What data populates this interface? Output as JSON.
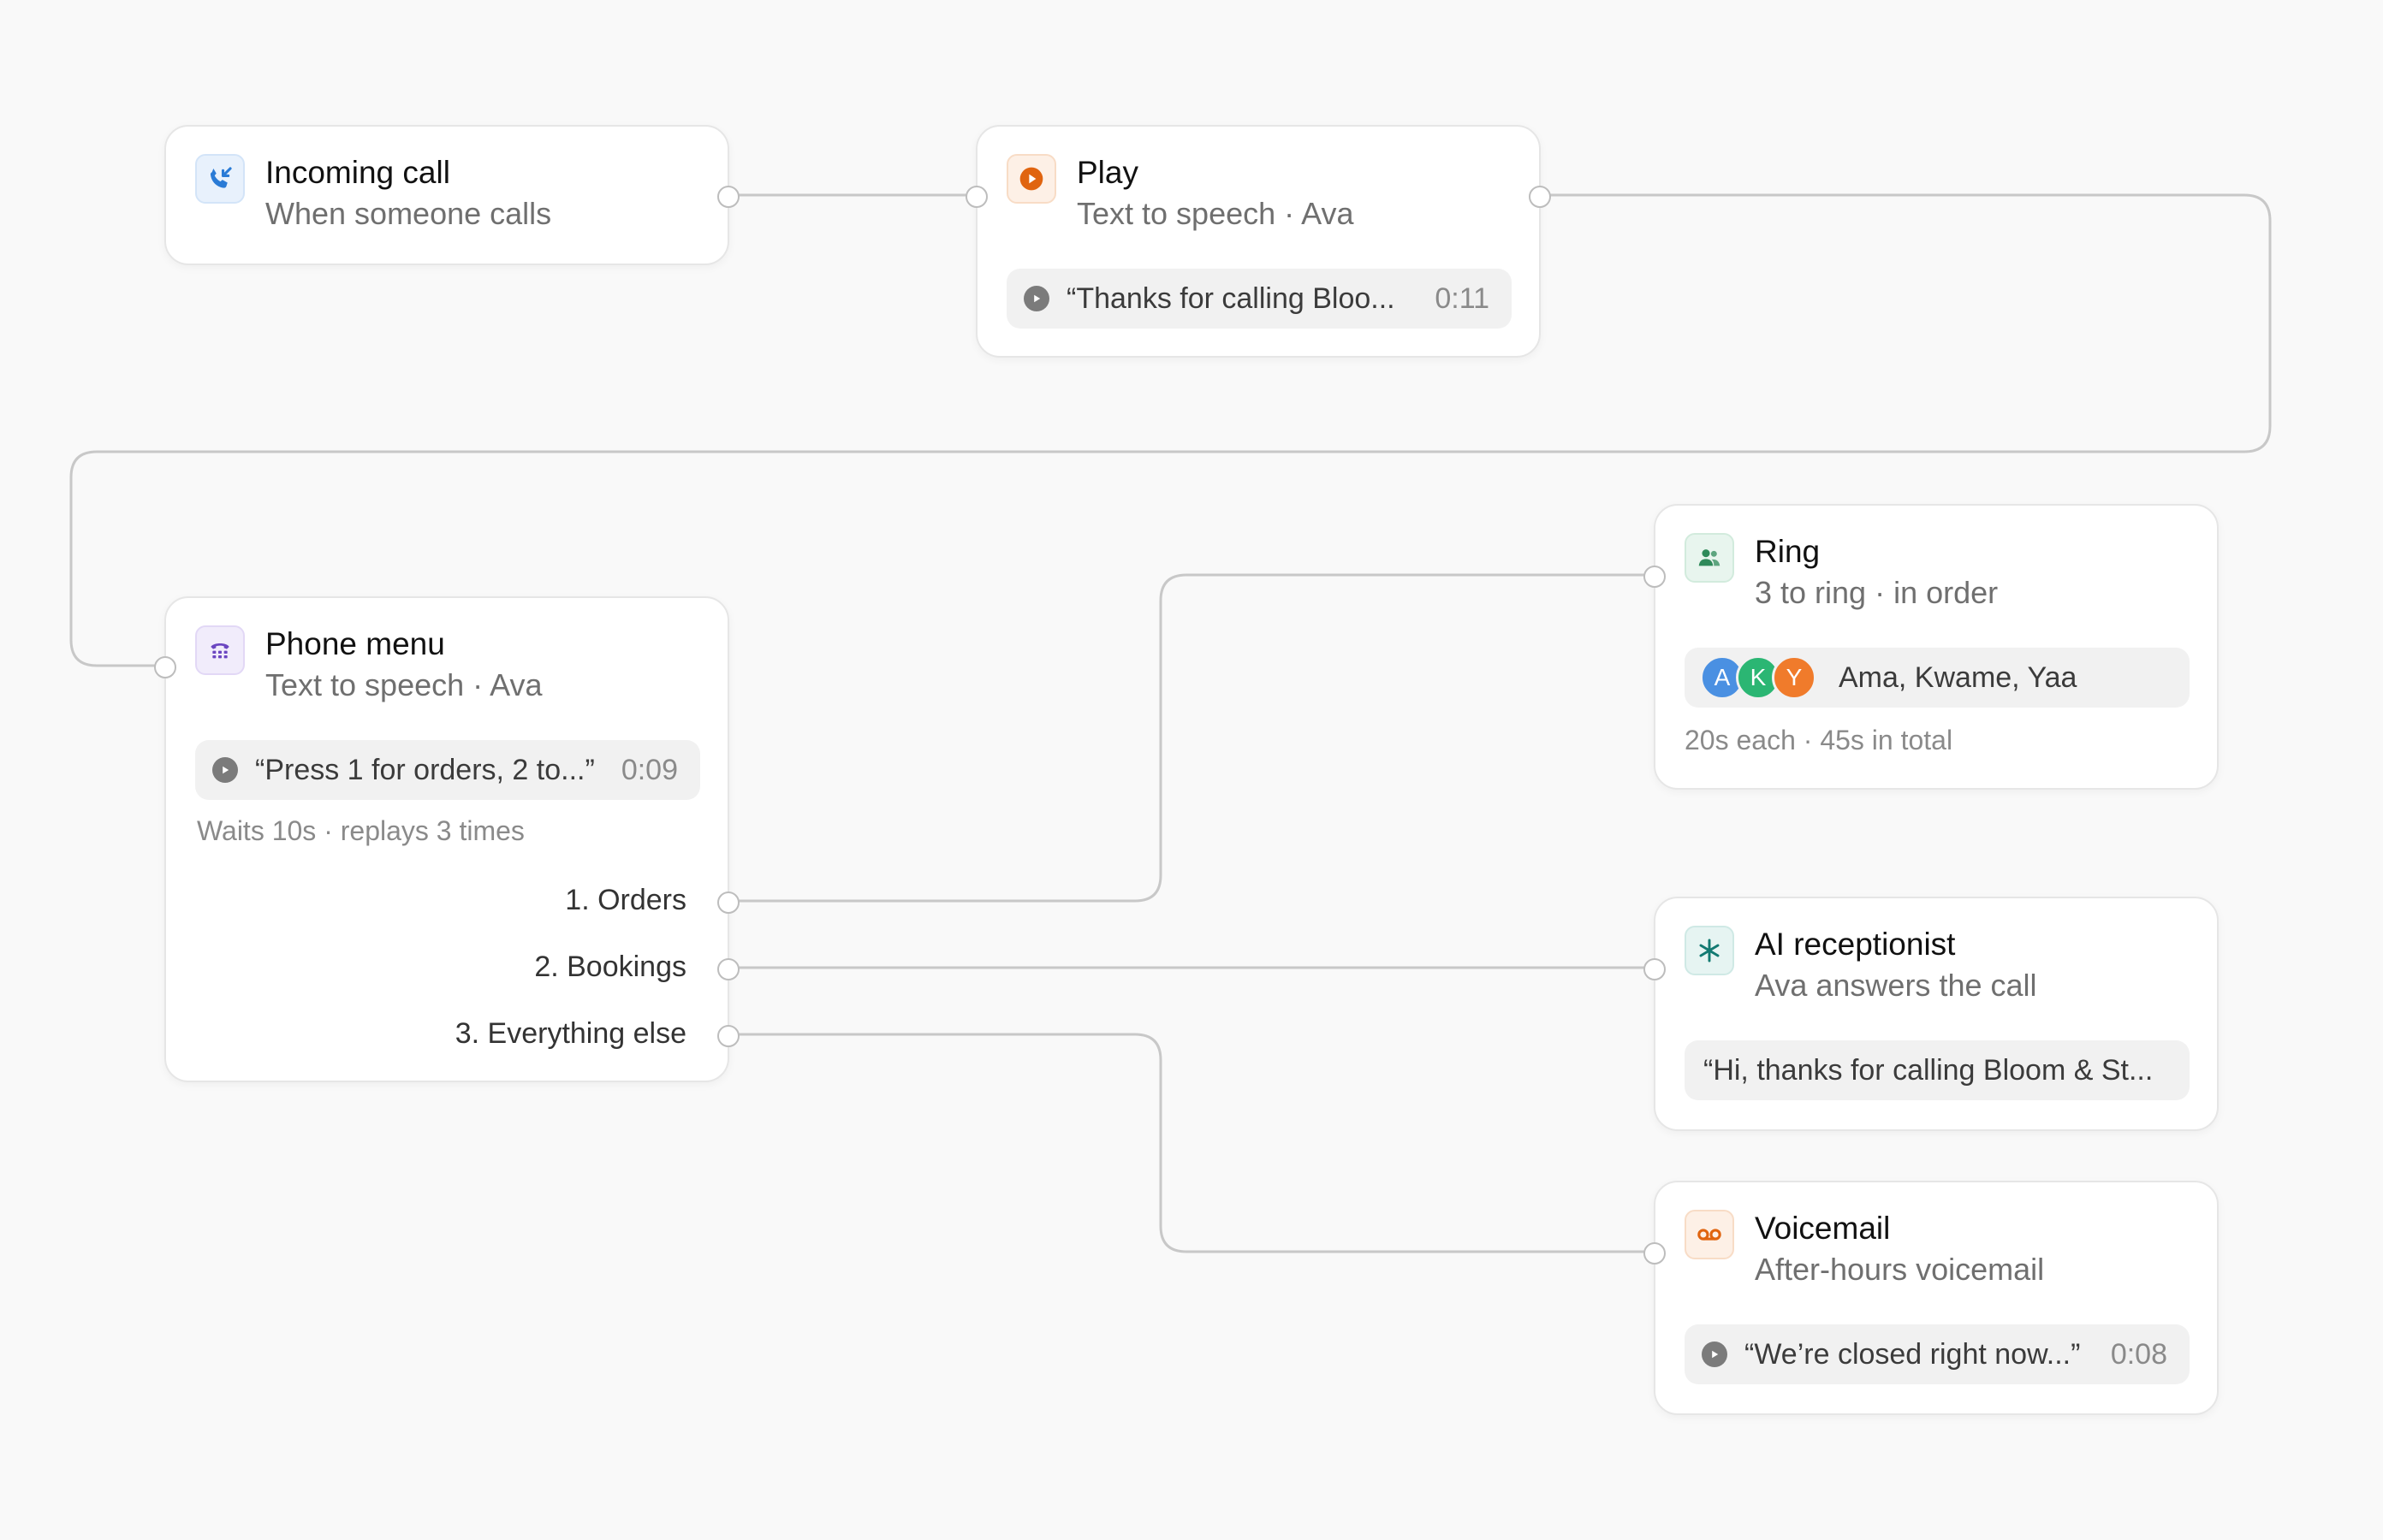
{
  "colors": {
    "canvas": "#f9f9f9",
    "wire": "#c8c8c8",
    "incoming_icon": "#2a7bd6",
    "play_icon": "#e0640f",
    "menu_icon": "#6b46c1",
    "ring_icon": "#2f8a5a",
    "ai_icon": "#127a72",
    "voicemail_icon": "#e0640f"
  },
  "nodes": {
    "incoming": {
      "icon": "incoming-call-icon",
      "title": "Incoming call",
      "subtitle": "When someone calls"
    },
    "play": {
      "icon": "play-icon",
      "title": "Play",
      "subtitle": "Text to speech · Ava",
      "clip": {
        "text": "“Thanks for calling Bloo...",
        "duration": "0:11"
      }
    },
    "menu": {
      "icon": "dialpad-icon",
      "title": "Phone menu",
      "subtitle": "Text to speech · Ava",
      "clip": {
        "text": "“Press 1 for orders, 2 to...”",
        "duration": "0:09"
      },
      "note": "Waits 10s · replays 3 times",
      "options": [
        "1. Orders",
        "2. Bookings",
        "3. Everything else"
      ]
    },
    "ring": {
      "icon": "people-icon",
      "title": "Ring",
      "subtitle": "3 to ring · in order",
      "people": {
        "initials": [
          "A",
          "K",
          "Y"
        ],
        "names": "Ama, Kwame, Yaa",
        "avatar_colors": [
          "#4a90e2",
          "#2bb673",
          "#f07b2b"
        ]
      },
      "note": "20s each · 45s in total"
    },
    "ai": {
      "icon": "sparkle-icon",
      "title": "AI receptionist",
      "subtitle": "Ava answers the call",
      "greeting": "“Hi, thanks for calling Bloom & St..."
    },
    "voicemail": {
      "icon": "voicemail-icon",
      "title": "Voicemail",
      "subtitle": "After-hours voicemail",
      "clip": {
        "text": "“We’re closed right now...”",
        "duration": "0:08"
      }
    }
  }
}
